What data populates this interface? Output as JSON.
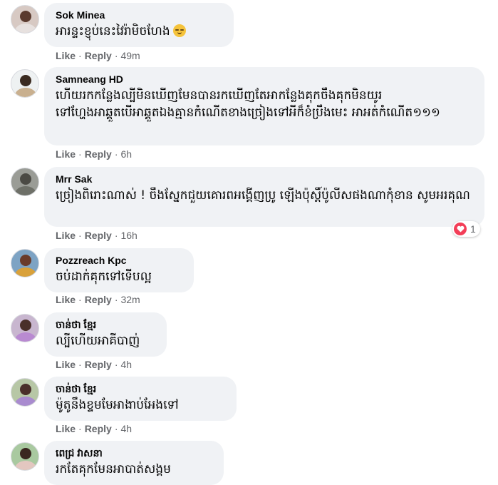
{
  "like_label": "Like",
  "reply_label": "Reply",
  "comments": [
    {
      "name": "Sok Minea",
      "text": "អារន្ទះខ្ញុប់នេះវៃរ៉ាមិចហែង",
      "time": "49m",
      "emoji": "sweat-smile-emoji"
    },
    {
      "name": "Samneang HD",
      "text": "ហើយរកកន្លែងល្បីមិនឃើញមែនបានរកឃើញតែអាកន្លែងគុកចឹងគុកមិនយូរទៅហ្ហែងអាឆ្គួតបើអាឆ្គួតឯងគ្មានកំណើតខាងច្រៀងទៅអីក៏ខំប្រឹងមេះ អាអត់កំណើត១១១",
      "time": "6h"
    },
    {
      "name": "Mrr Sak",
      "text": "ច្រៀងពិរោះណាស់ ! ចឹងស្នែកជួយគោរពអង្គើញប្រូ ឡើងប៉ុស្តិ៍ប៉ូលីសផងណាកុំខាន សូមអរគុណ",
      "time": "16h",
      "reaction_count": "1"
    },
    {
      "name": "Pozzreach Kpc",
      "text": "ចប់ដាក់គុកទៅទើបល្អ",
      "time": "32m"
    },
    {
      "name": "ចាន់ថា ខ្មែរ",
      "text": "ល្បីហើយអាគីបាញ់",
      "time": "4h"
    },
    {
      "name": "ចាន់ថា ខ្មែរ",
      "text": "ម៉ូតូនឹងខ្ទមមែអាងាប់អែងទៅ",
      "time": "4h"
    },
    {
      "name": "ពេជ្រ វាសនា",
      "text": "រកតែគុកមែនអាបាត់សង្គម"
    }
  ],
  "colors": {
    "bubble": "#f0f2f5",
    "meta": "#65676b",
    "reaction_heart": "#f33e58"
  }
}
